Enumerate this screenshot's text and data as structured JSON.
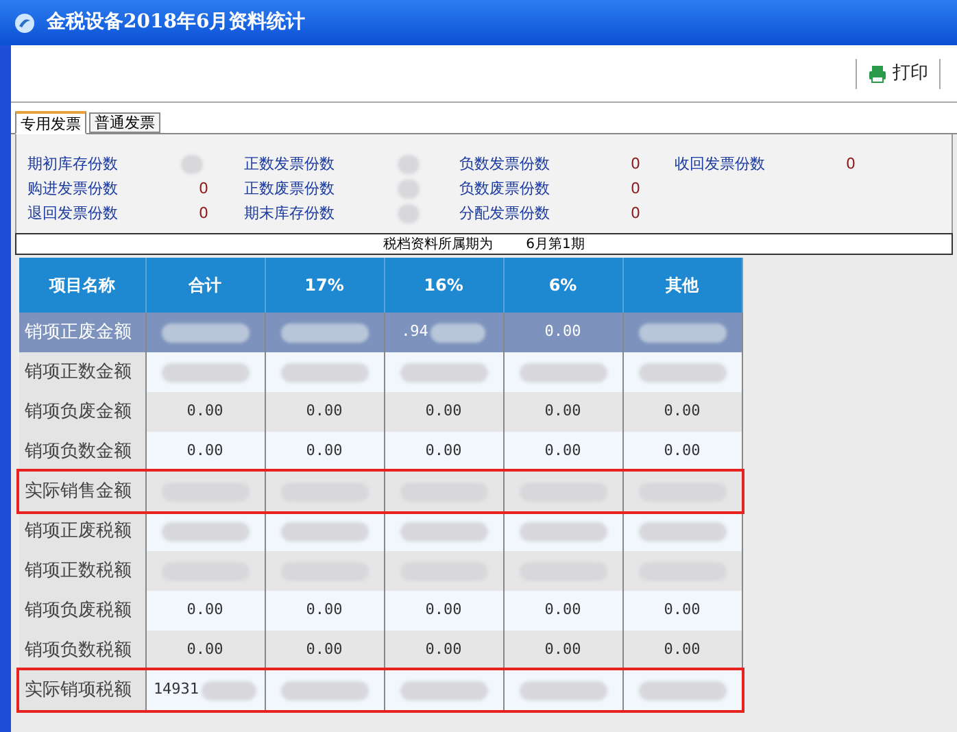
{
  "window": {
    "title": "金税设备2018年6月资料统计"
  },
  "toolbar": {
    "print_button": "打印"
  },
  "tabs": [
    {
      "label": "专用发票",
      "selected": true
    },
    {
      "label": "普通发票",
      "selected": false
    }
  ],
  "summary": [
    [
      {
        "label": "期初库存份数",
        "redacted": true
      },
      {
        "label": "正数发票份数",
        "redacted": true
      },
      {
        "label": "负数发票份数",
        "value": "0"
      },
      {
        "label": "收回发票份数",
        "value": "0"
      }
    ],
    [
      {
        "label": "购进发票份数",
        "value": "0"
      },
      {
        "label": "正数废票份数",
        "redacted": true
      },
      {
        "label": "负数废票份数",
        "value": "0"
      }
    ],
    [
      {
        "label": "退回发票份数",
        "value": "0"
      },
      {
        "label": "期末库存份数",
        "redacted": true
      },
      {
        "label": "分配发票份数",
        "value": "0"
      }
    ]
  ],
  "period": {
    "label": "税档资料所属期为",
    "value": "6月第1期"
  },
  "table": {
    "columns": [
      "项目名称",
      "合计",
      "17%",
      "16%",
      "6%",
      "其他"
    ],
    "rows": [
      {
        "selected": true,
        "highlighted": false,
        "cells": [
          {
            "value": "销项正废金额"
          },
          {
            "redacted": true
          },
          {
            "redacted": true
          },
          {
            "value": ".94",
            "redacted": true
          },
          {
            "value": "0.00"
          },
          {
            "redacted": true
          }
        ]
      },
      {
        "selected": false,
        "highlighted": false,
        "cells": [
          {
            "value": "销项正数金额"
          },
          {
            "redacted": true
          },
          {
            "redacted": true
          },
          {
            "redacted": true
          },
          {
            "redacted": true
          },
          {
            "redacted": true
          }
        ]
      },
      {
        "selected": false,
        "highlighted": false,
        "cells": [
          {
            "value": "销项负废金额"
          },
          {
            "value": "0.00"
          },
          {
            "value": "0.00"
          },
          {
            "value": "0.00"
          },
          {
            "value": "0.00"
          },
          {
            "value": "0.00"
          }
        ]
      },
      {
        "selected": false,
        "highlighted": false,
        "cells": [
          {
            "value": "销项负数金额"
          },
          {
            "value": "0.00"
          },
          {
            "value": "0.00"
          },
          {
            "value": "0.00"
          },
          {
            "value": "0.00"
          },
          {
            "value": "0.00"
          }
        ]
      },
      {
        "selected": false,
        "highlighted": true,
        "cells": [
          {
            "value": "实际销售金额"
          },
          {
            "redacted": true
          },
          {
            "redacted": true
          },
          {
            "redacted": true
          },
          {
            "redacted": true
          },
          {
            "redacted": true
          }
        ]
      },
      {
        "selected": false,
        "highlighted": false,
        "cells": [
          {
            "value": "销项正废税额"
          },
          {
            "redacted": true
          },
          {
            "redacted": true
          },
          {
            "redacted": true
          },
          {
            "redacted": true
          },
          {
            "redacted": true
          }
        ]
      },
      {
        "selected": false,
        "highlighted": false,
        "cells": [
          {
            "value": "销项正数税额"
          },
          {
            "redacted": true
          },
          {
            "redacted": true
          },
          {
            "redacted": true
          },
          {
            "redacted": true
          },
          {
            "redacted": true
          }
        ]
      },
      {
        "selected": false,
        "highlighted": false,
        "cells": [
          {
            "value": "销项负废税额"
          },
          {
            "value": "0.00"
          },
          {
            "value": "0.00"
          },
          {
            "value": "0.00"
          },
          {
            "value": "0.00"
          },
          {
            "value": "0.00"
          }
        ]
      },
      {
        "selected": false,
        "highlighted": false,
        "cells": [
          {
            "value": "销项负数税额"
          },
          {
            "value": "0.00"
          },
          {
            "value": "0.00"
          },
          {
            "value": "0.00"
          },
          {
            "value": "0.00"
          },
          {
            "value": "0.00"
          }
        ]
      },
      {
        "selected": false,
        "highlighted": true,
        "cells": [
          {
            "value": "实际销项税额"
          },
          {
            "value": "14931",
            "redacted": true
          },
          {
            "redacted": true
          },
          {
            "redacted": true
          },
          {
            "redacted": true
          },
          {
            "redacted": true
          }
        ]
      }
    ]
  }
}
